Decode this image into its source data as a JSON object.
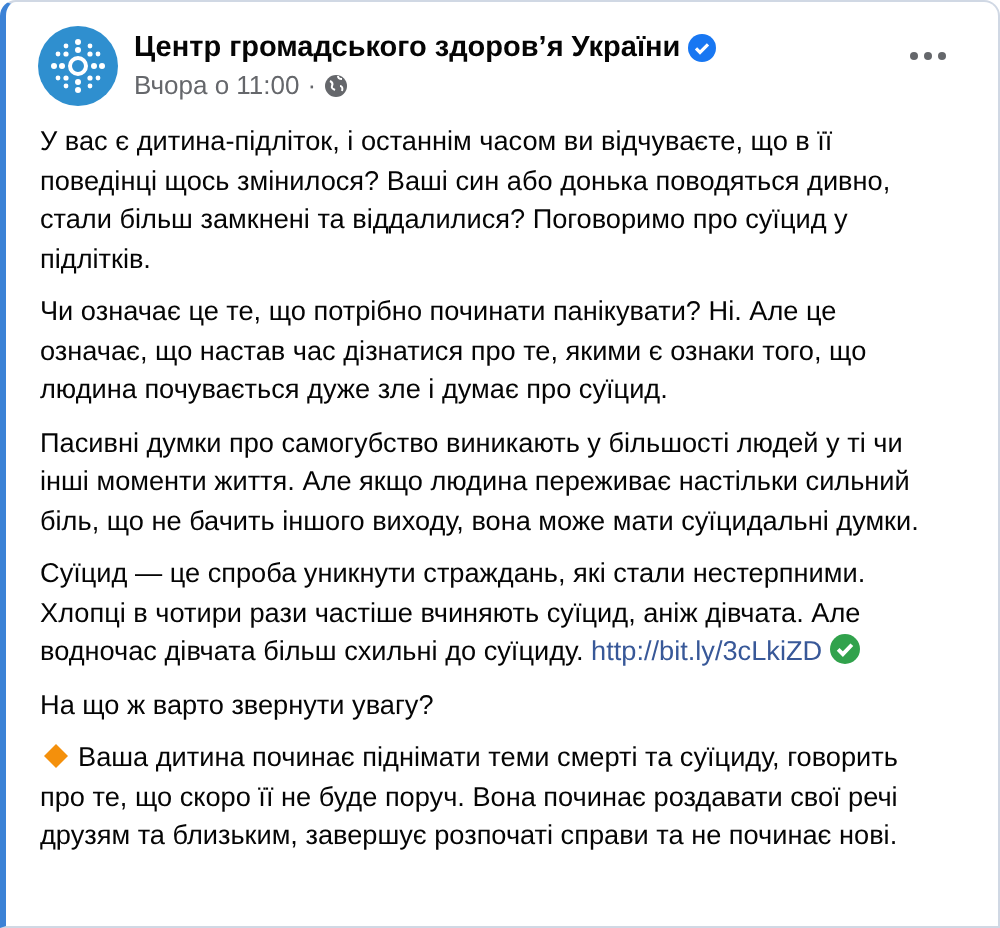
{
  "post": {
    "author": "Центр громадського здоров’я України",
    "verified": true,
    "time": "Вчора о 11:00",
    "separator": "·",
    "paragraphs": [
      {
        "kind": "text",
        "text": "У вас є дитина-підліток, і останнім часом ви відчуваєте, що в її поведінці щось змінилося? Ваші син або донька поводяться дивно, стали більш замкнені та віддалилися? Поговоримо про суїцид у підлітків."
      },
      {
        "kind": "text",
        "text": "Чи означає це те, що потрібно починати панікувати? Ні. Але це означає, що настав час дізнатися про те, якими є ознаки того, що людина почувається дуже зле і думає про суїцид."
      },
      {
        "kind": "text",
        "text": "Пасивні думки про самогубство виникають у більшості людей у ті чи інші моменти життя. Але якщо людина переживає настільки сильний біль, що не бачить іншого виходу, вона може мати суїцидальні думки."
      },
      {
        "kind": "link",
        "text": "Суїцид — це спроба уникнути страждань, які стали нестерпними. Хлопці в чотири рази частіше вчиняють суїцид, аніж дівчата. Але водночас дівчата більш схильні до суїциду.",
        "link": "http://bit.ly/3cLkiZD"
      },
      {
        "kind": "text",
        "text": "На що ж варто звернути увагу?"
      },
      {
        "kind": "bullet",
        "text": "Ваша дитина починає піднімати теми смерті та суїциду, говорить про те, що скоро її не буде поруч. Вона починає роздавати свої речі друзям та близьким, завершує розпочаті справи та не починає нові."
      }
    ]
  }
}
